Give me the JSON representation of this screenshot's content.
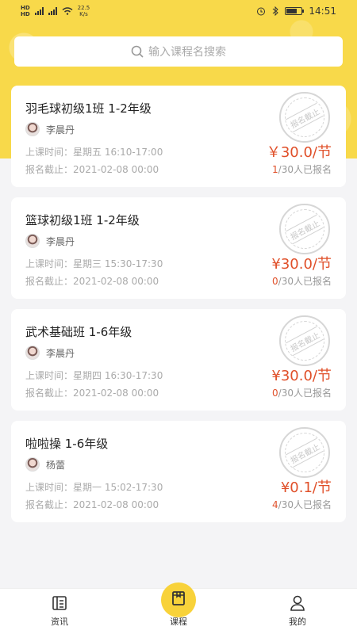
{
  "status_bar": {
    "network_speed": "22.5",
    "network_speed_unit": "K/s",
    "time": "14:51"
  },
  "search": {
    "placeholder": "输入课程名搜索"
  },
  "stamp_text": "报名截止",
  "courses": [
    {
      "title": "羽毛球初级1班 1-2年级",
      "teacher": "李晨丹",
      "time_label": "上课时间：",
      "time": "星期五 16:10-17:00",
      "deadline_label": "报名截止：",
      "deadline": "2021-02-08 00:00",
      "price": "￥30.0/节",
      "enrolled": "1",
      "enroll_suffix": "/30人已报名"
    },
    {
      "title": "篮球初级1班 1-2年级",
      "teacher": "李晨丹",
      "time_label": "上课时间：",
      "time": "星期三 15:30-17:30",
      "deadline_label": "报名截止：",
      "deadline": "2021-02-08 00:00",
      "price": "¥30.0/节",
      "enrolled": "0",
      "enroll_suffix": "/30人已报名"
    },
    {
      "title": "武术基础班  1-6年级",
      "teacher": "李晨丹",
      "time_label": "上课时间：",
      "time": "星期四 16:30-17:30",
      "deadline_label": "报名截止：",
      "deadline": "2021-02-08 00:00",
      "price": "¥30.0/节",
      "enrolled": "0",
      "enroll_suffix": "/30人已报名"
    },
    {
      "title": "啦啦操 1-6年级",
      "teacher": "杨蕾",
      "time_label": "上课时间：",
      "time": "星期一 15:02-17:30",
      "deadline_label": "报名截止：",
      "deadline": "2021-02-08 00:00",
      "price": "¥0.1/节",
      "enrolled": "4",
      "enroll_suffix": "/30人已报名"
    }
  ],
  "tabs": [
    {
      "label": "资讯",
      "icon": "news-icon"
    },
    {
      "label": "课程",
      "icon": "course-icon",
      "active": true
    },
    {
      "label": "我的",
      "icon": "profile-icon"
    }
  ],
  "colors": {
    "accent": "#f8d94a",
    "price": "#e0502a"
  }
}
